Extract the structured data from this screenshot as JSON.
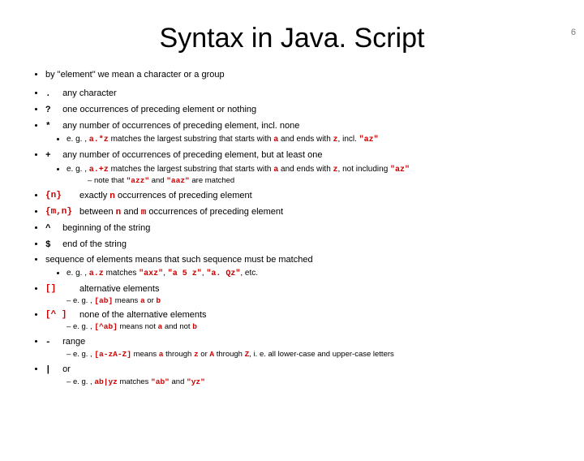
{
  "page_number": "6",
  "title": "Syntax in Java. Script",
  "intro": "by \"element\" we mean a character or a group",
  "items": [
    {
      "sym": ".",
      "desc": "any character"
    },
    {
      "sym": "?",
      "desc": "one occurrences of preceding element or nothing"
    },
    {
      "sym": "*",
      "desc": "any number of occurrences of preceding element, incl. none",
      "sub": {
        "prefix": "e. g. , ",
        "code1": "a.*z",
        "mid1": " matches the largest substring that starts with ",
        "a": "a",
        "mid2": " and ends with ",
        "z": "z",
        "mid3": ", incl. ",
        "q": "\"az\""
      }
    },
    {
      "sym": "+",
      "desc": "any number of occurrences of preceding element, but at least one",
      "sub": {
        "prefix": "e. g. , ",
        "code1": "a.+z",
        "mid1": " matches the largest substring that starts with ",
        "a": "a",
        "mid2": " and ends with ",
        "z": "z",
        "mid3": ", not including ",
        "q": "\"az\""
      },
      "note": {
        "prefix": "note that ",
        "q1": "\"azz\"",
        "and": " and ",
        "q2": "\"aaz\"",
        "tail": " are matched"
      }
    },
    {
      "sym": "{n}",
      "d1": "exactly ",
      "n": "n",
      "d2": " occurrences of preceding element"
    },
    {
      "sym": "{m,n}",
      "d1": "between ",
      "n": "n",
      "d2": " and ",
      "m": "m",
      "d3": " occurrences of preceding element"
    },
    {
      "sym": "^",
      "desc": "beginning of the string"
    },
    {
      "sym": "$",
      "desc": "end of the string"
    },
    {
      "sym": "",
      "desc": "sequence of elements means that such sequence must be matched",
      "sub": {
        "prefix": "e. g. , ",
        "code1": "a.z",
        "mid1": " matches ",
        "q1": "\"axz\"",
        "c1": ", ",
        "q2": "\"a 5 z\"",
        "c2": ", ",
        "q3": "\"a. Qz\"",
        "tail": ", etc."
      }
    },
    {
      "sym": "[]",
      "desc": "alternative elements",
      "sub2": {
        "prefix": "e. g. , ",
        "code1": "[ab]",
        "mid1": " means ",
        "a": "a",
        "or": " or ",
        "b": "b"
      }
    },
    {
      "sym": "[^ ]",
      "desc": "none of the alternative elements",
      "sub2": {
        "prefix": "e. g. , ",
        "code1": "[^ab]",
        "mid1": " means not ",
        "a": "a",
        "and": " and not ",
        "b": "b"
      }
    },
    {
      "sym": "-",
      "desc": "range",
      "sub2": {
        "prefix": "e. g. , ",
        "code1": "[a-zA-Z]",
        "mid1": " means ",
        "a": "a",
        "thr1": " through ",
        "z": "z",
        "or": " or ",
        "A": "A",
        "thr2": " through ",
        "Z": "Z",
        "tail": ", i. e. all lower-case and upper-case letters"
      }
    },
    {
      "sym": "|",
      "desc": "or",
      "sub2": {
        "prefix": "e. g. , ",
        "code1": "ab|yz",
        "mid1": " matches ",
        "q1": "\"ab\"",
        "and": " and ",
        "q2": "\"yz\""
      }
    }
  ]
}
